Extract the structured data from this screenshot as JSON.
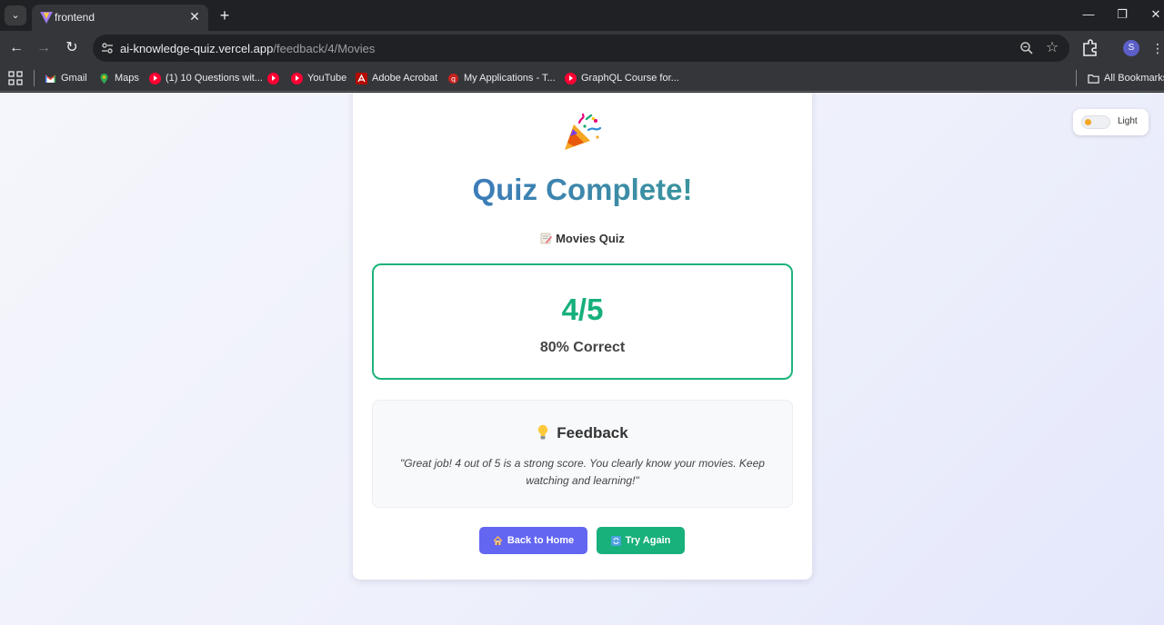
{
  "browser": {
    "tab_title": "frontend",
    "url_domain": "ai-knowledge-quiz.vercel.app",
    "url_path": "/feedback/4/Movies",
    "profile_initial": "S",
    "bookmarks": [
      {
        "label": "Gmail",
        "icon": "gmail-icon"
      },
      {
        "label": "Maps",
        "icon": "maps-icon"
      },
      {
        "label": "(1) 10 Questions wit...",
        "icon": "youtube-icon"
      },
      {
        "label": "",
        "icon": "youtube-icon"
      },
      {
        "label": "YouTube",
        "icon": "youtube-icon"
      },
      {
        "label": "Adobe Acrobat",
        "icon": "acrobat-icon"
      },
      {
        "label": "My Applications - T...",
        "icon": "app-icon"
      },
      {
        "label": "GraphQL Course for...",
        "icon": "youtube-icon"
      }
    ],
    "all_bookmarks_label": "All Bookmarks"
  },
  "theme_toggle": {
    "label": "Light"
  },
  "quiz": {
    "title": "Quiz Complete!",
    "subtitle": "Movies Quiz",
    "score": "4/5",
    "percent_label": "80% Correct",
    "score_fraction": 0.8
  },
  "feedback": {
    "heading": "Feedback",
    "text": "\"Great job! 4 out of 5 is a strong score. You clearly know your movies. Keep watching and learning!\""
  },
  "actions": {
    "home_label": "Back to Home",
    "retry_label": "Try Again"
  },
  "colors": {
    "accent_indigo": "#6366f1",
    "accent_green": "#18b07b",
    "score_green": "#16b07b"
  }
}
